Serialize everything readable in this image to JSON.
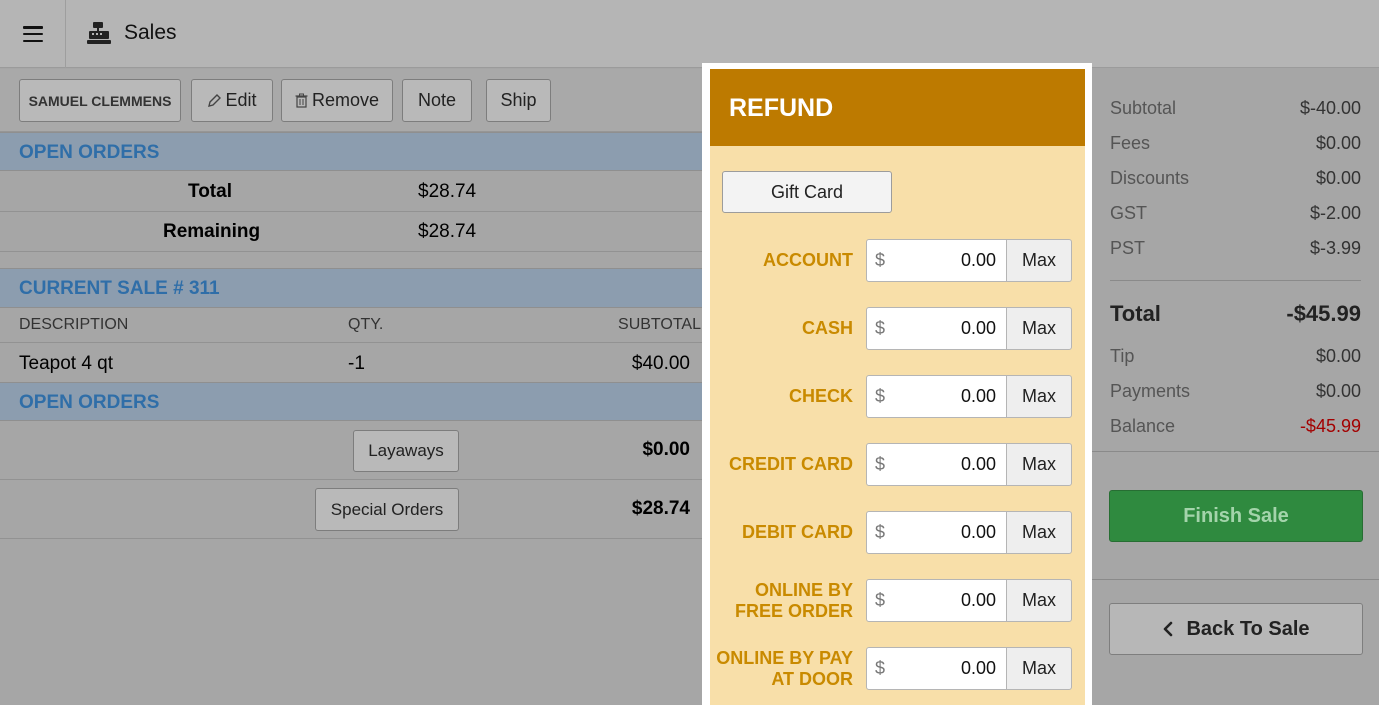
{
  "app": {
    "title": "Sales"
  },
  "customer_bar": {
    "customer": "SAMUEL CLEMMENS",
    "edit": "Edit",
    "remove": "Remove",
    "note": "Note",
    "ship": "Ship"
  },
  "open_orders_top": {
    "heading": "OPEN ORDERS",
    "total_label": "Total",
    "total_value": "$28.74",
    "remaining_label": "Remaining",
    "remaining_value": "$28.74"
  },
  "current_sale": {
    "heading": "CURRENT SALE # 311",
    "columns": [
      "DESCRIPTION",
      "QTY.",
      "SUBTOTAL"
    ],
    "items": [
      {
        "description": "Teapot 4 qt",
        "qty": "-1",
        "subtotal": "$40.00"
      }
    ]
  },
  "open_orders_bottom": {
    "heading": "OPEN ORDERS",
    "layaways_label": "Layaways",
    "layaways_value": "$0.00",
    "special_orders_label": "Special Orders",
    "special_orders_value": "$28.74"
  },
  "refund": {
    "heading": "REFUND",
    "gift_card": "Gift Card",
    "currency": "$",
    "max_label": "Max",
    "methods": [
      {
        "line1": "ACCOUNT",
        "line2": "",
        "value": "0.00"
      },
      {
        "line1": "CASH",
        "line2": "",
        "value": "0.00"
      },
      {
        "line1": "CHECK",
        "line2": "",
        "value": "0.00"
      },
      {
        "line1": "CREDIT CARD",
        "line2": "",
        "value": "0.00"
      },
      {
        "line1": "DEBIT CARD",
        "line2": "",
        "value": "0.00"
      },
      {
        "line1": "ONLINE BY",
        "line2": "FREE ORDER",
        "value": "0.00"
      },
      {
        "line1": "ONLINE BY PAY",
        "line2": "AT DOOR",
        "value": "0.00"
      }
    ]
  },
  "summary": {
    "subtotal_label": "Subtotal",
    "subtotal": "$-40.00",
    "fees_label": "Fees",
    "fees": "$0.00",
    "discounts_label": "Discounts",
    "discounts": "$0.00",
    "gst_label": "GST",
    "gst": "$-2.00",
    "pst_label": "PST",
    "pst": "$-3.99",
    "total_label": "Total",
    "total": "-$45.99",
    "tip_label": "Tip",
    "tip": "$0.00",
    "payments_label": "Payments",
    "payments": "$0.00",
    "balance_label": "Balance",
    "balance": "-$45.99",
    "balance_color": "#a30000"
  },
  "actions": {
    "finish": "Finish Sale",
    "back": "Back To Sale"
  }
}
